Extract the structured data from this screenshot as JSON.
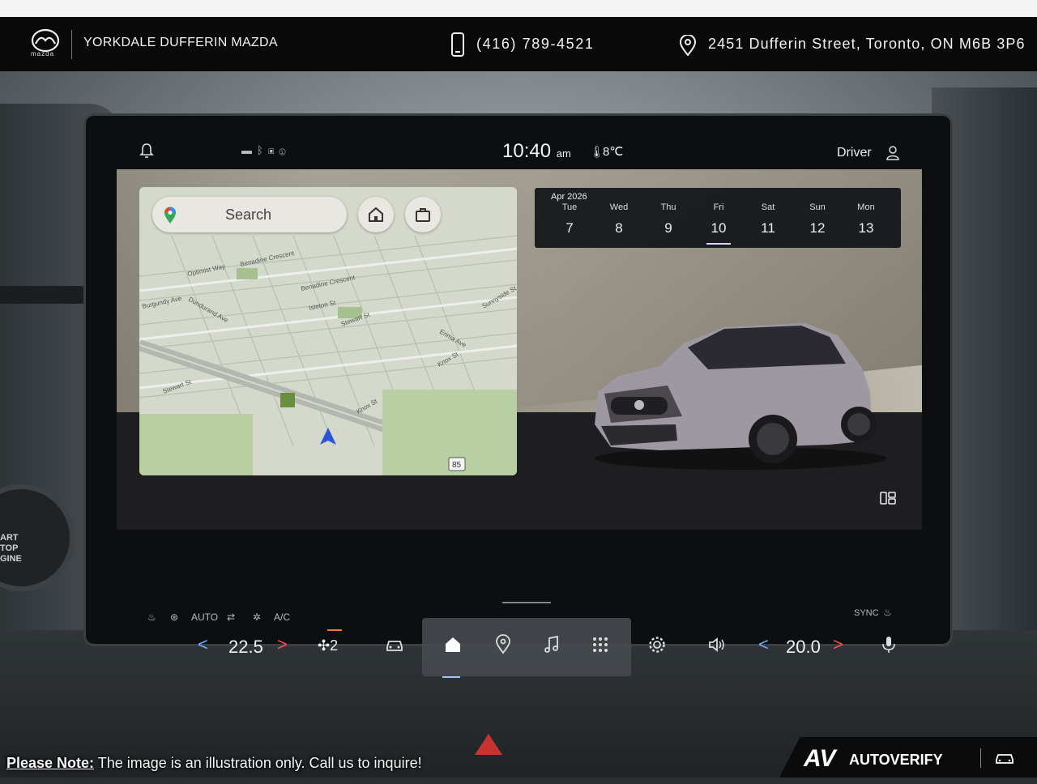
{
  "dealer": {
    "logo_text": "mazda",
    "name": "YORKDALE DUFFERIN MAZDA",
    "phone": "(416) 789-4521",
    "address": "2451 Dufferin Street, Toronto, ON M6B 3P6"
  },
  "infotainment": {
    "status_bar": {
      "time": "10:40",
      "ampm": "am",
      "temperature": "8℃",
      "profile": "Driver",
      "icons": [
        "bell-icon",
        "message-icon",
        "bluetooth-icon",
        "sim-icon",
        "alert-icon"
      ]
    },
    "map": {
      "search_placeholder": "Search",
      "streets": [
        "Optimist Way",
        "Benadine Crescent",
        "Benadine Crescent",
        "Dundurand Ave",
        "Isleton St",
        "Stewart St",
        "Stewart St",
        "Knox St",
        "Knox St",
        "Erima Ave",
        "Sunnyside St",
        "Burgundy Ave",
        "85"
      ]
    },
    "calendar": {
      "month": "Apr 2026",
      "days": [
        {
          "dow": "Tue",
          "num": "7"
        },
        {
          "dow": "Wed",
          "num": "8"
        },
        {
          "dow": "Thu",
          "num": "9"
        },
        {
          "dow": "Fri",
          "num": "10"
        },
        {
          "dow": "Sat",
          "num": "11"
        },
        {
          "dow": "Sun",
          "num": "12"
        },
        {
          "dow": "Mon",
          "num": "13"
        }
      ],
      "selected": "10"
    },
    "climate": {
      "auto_label": "AUTO",
      "ac_label": "A/C",
      "sync_label": "SYNC",
      "left_temp": "22.5",
      "right_temp": "20.0",
      "fan_level": "2"
    },
    "dock_active": "home"
  },
  "start_button_text": [
    "ART",
    "TOP",
    "GINE"
  ],
  "footer": {
    "note_label": "Please Note:",
    "note_text": " The image is an illustration only. Call us to inquire!",
    "brand": "AUTOVERIFY",
    "brand_mark": "AV"
  }
}
